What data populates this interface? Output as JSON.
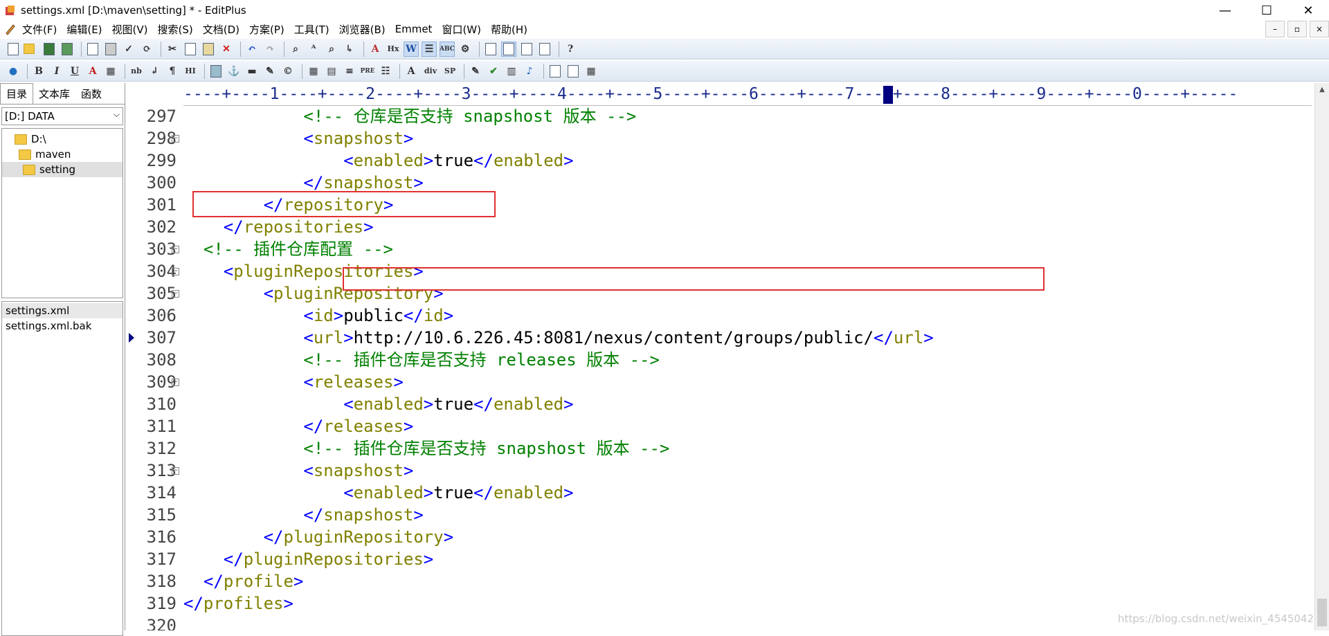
{
  "window": {
    "title": "settings.xml [D:\\maven\\setting] * - EditPlus",
    "controls": {
      "minimize": "—",
      "maximize": "☐",
      "close": "✕"
    }
  },
  "menu": [
    "文件(F)",
    "编辑(E)",
    "视图(V)",
    "搜索(S)",
    "文档(D)",
    "方案(P)",
    "工具(T)",
    "浏览器(B)",
    "Emmet",
    "窗口(W)",
    "帮助(H)"
  ],
  "mdi_controls": {
    "minimize": "–",
    "restore": "▫",
    "close": "×"
  },
  "toolbar2_labels": {
    "bold": "B",
    "italic": "I",
    "underline": "U",
    "font_color": "A",
    "nb": "nb",
    "br": "↲",
    "para": "¶",
    "hr": "HI",
    "pre": "PRE",
    "div": "div",
    "sp": "SP"
  },
  "left_panel": {
    "tabs": [
      "目录",
      "文本库",
      "函数"
    ],
    "drive": "[D:] DATA",
    "tree": [
      "D:\\",
      "maven",
      "setting"
    ],
    "files": [
      "settings.xml",
      "settings.xml.bak"
    ]
  },
  "ruler": "----+----1----+----2----+----3----+----4----+----5----+----6----+----7---",
  "ruler_tail": "+----8----+----9----+----0----+-----",
  "code_lines": [
    {
      "n": "297",
      "indent": "            ",
      "parts": [
        {
          "c": "cm",
          "t": "<!-- 仓库是否支持 snapshost 版本 -->"
        }
      ]
    },
    {
      "n": "298",
      "indent": "            ",
      "fold": "⊟",
      "parts": [
        {
          "c": "tg",
          "t": "<"
        },
        {
          "c": "nm",
          "t": "snapshost"
        },
        {
          "c": "tg",
          "t": ">"
        }
      ]
    },
    {
      "n": "299",
      "indent": "                ",
      "parts": [
        {
          "c": "tg",
          "t": "<"
        },
        {
          "c": "nm",
          "t": "enabled"
        },
        {
          "c": "tg",
          "t": ">"
        },
        {
          "c": "tx",
          "t": "true"
        },
        {
          "c": "tg",
          "t": "</"
        },
        {
          "c": "nm",
          "t": "enabled"
        },
        {
          "c": "tg",
          "t": ">"
        }
      ]
    },
    {
      "n": "300",
      "indent": "            ",
      "parts": [
        {
          "c": "tg",
          "t": "</"
        },
        {
          "c": "nm",
          "t": "snapshost"
        },
        {
          "c": "tg",
          "t": ">"
        }
      ]
    },
    {
      "n": "301",
      "indent": "        ",
      "parts": [
        {
          "c": "tg",
          "t": "</"
        },
        {
          "c": "nm",
          "t": "repository"
        },
        {
          "c": "tg",
          "t": ">"
        }
      ]
    },
    {
      "n": "302",
      "indent": "    ",
      "parts": [
        {
          "c": "tg",
          "t": "</"
        },
        {
          "c": "nm",
          "t": "repositories"
        },
        {
          "c": "tg",
          "t": ">"
        }
      ]
    },
    {
      "n": "303",
      "indent": "  ",
      "fold": "⊟",
      "parts": [
        {
          "c": "cm",
          "t": "<!-- 插件仓库配置 -->"
        }
      ]
    },
    {
      "n": "304",
      "indent": "    ",
      "fold": "⊟",
      "parts": [
        {
          "c": "tg",
          "t": "<"
        },
        {
          "c": "nm",
          "t": "pluginRepositories"
        },
        {
          "c": "tg",
          "t": ">"
        }
      ]
    },
    {
      "n": "305",
      "indent": "        ",
      "fold": "⊟",
      "parts": [
        {
          "c": "tg",
          "t": "<"
        },
        {
          "c": "nm",
          "t": "pluginRepository"
        },
        {
          "c": "tg",
          "t": ">"
        }
      ]
    },
    {
      "n": "306",
      "indent": "            ",
      "parts": [
        {
          "c": "tg",
          "t": "<"
        },
        {
          "c": "nm",
          "t": "id"
        },
        {
          "c": "tg",
          "t": ">"
        },
        {
          "c": "tx",
          "t": "public"
        },
        {
          "c": "tg",
          "t": "</"
        },
        {
          "c": "nm",
          "t": "id"
        },
        {
          "c": "tg",
          "t": ">"
        }
      ]
    },
    {
      "n": "307",
      "indent": "            ",
      "current": true,
      "parts": [
        {
          "c": "tg",
          "t": "<"
        },
        {
          "c": "nm",
          "t": "url"
        },
        {
          "c": "tg",
          "t": ">"
        },
        {
          "c": "tx",
          "t": "http://10.6.226.45:8081/nexus/content/groups/public/"
        },
        {
          "c": "tg",
          "t": "</"
        },
        {
          "c": "nm",
          "t": "url"
        },
        {
          "c": "tg",
          "t": ">"
        }
      ]
    },
    {
      "n": "308",
      "indent": "            ",
      "parts": [
        {
          "c": "cm",
          "t": "<!-- 插件仓库是否支持 releases 版本 -->"
        }
      ]
    },
    {
      "n": "309",
      "indent": "            ",
      "fold": "⊟",
      "parts": [
        {
          "c": "tg",
          "t": "<"
        },
        {
          "c": "nm",
          "t": "releases"
        },
        {
          "c": "tg",
          "t": ">"
        }
      ]
    },
    {
      "n": "310",
      "indent": "                ",
      "parts": [
        {
          "c": "tg",
          "t": "<"
        },
        {
          "c": "nm",
          "t": "enabled"
        },
        {
          "c": "tg",
          "t": ">"
        },
        {
          "c": "tx",
          "t": "true"
        },
        {
          "c": "tg",
          "t": "</"
        },
        {
          "c": "nm",
          "t": "enabled"
        },
        {
          "c": "tg",
          "t": ">"
        }
      ]
    },
    {
      "n": "311",
      "indent": "            ",
      "parts": [
        {
          "c": "tg",
          "t": "</"
        },
        {
          "c": "nm",
          "t": "releases"
        },
        {
          "c": "tg",
          "t": ">"
        }
      ]
    },
    {
      "n": "312",
      "indent": "            ",
      "parts": [
        {
          "c": "cm",
          "t": "<!-- 插件仓库是否支持 snapshost 版本 -->"
        }
      ]
    },
    {
      "n": "313",
      "indent": "            ",
      "fold": "⊟",
      "parts": [
        {
          "c": "tg",
          "t": "<"
        },
        {
          "c": "nm",
          "t": "snapshost"
        },
        {
          "c": "tg",
          "t": ">"
        }
      ]
    },
    {
      "n": "314",
      "indent": "                ",
      "parts": [
        {
          "c": "tg",
          "t": "<"
        },
        {
          "c": "nm",
          "t": "enabled"
        },
        {
          "c": "tg",
          "t": ">"
        },
        {
          "c": "tx",
          "t": "true"
        },
        {
          "c": "tg",
          "t": "</"
        },
        {
          "c": "nm",
          "t": "enabled"
        },
        {
          "c": "tg",
          "t": ">"
        }
      ]
    },
    {
      "n": "315",
      "indent": "            ",
      "parts": [
        {
          "c": "tg",
          "t": "</"
        },
        {
          "c": "nm",
          "t": "snapshost"
        },
        {
          "c": "tg",
          "t": ">"
        }
      ]
    },
    {
      "n": "316",
      "indent": "        ",
      "parts": [
        {
          "c": "tg",
          "t": "</"
        },
        {
          "c": "nm",
          "t": "pluginRepository"
        },
        {
          "c": "tg",
          "t": ">"
        }
      ]
    },
    {
      "n": "317",
      "indent": "    ",
      "parts": [
        {
          "c": "tg",
          "t": "</"
        },
        {
          "c": "nm",
          "t": "pluginRepositories"
        },
        {
          "c": "tg",
          "t": ">"
        }
      ]
    },
    {
      "n": "318",
      "indent": "  ",
      "parts": [
        {
          "c": "tg",
          "t": "</"
        },
        {
          "c": "nm",
          "t": "profile"
        },
        {
          "c": "tg",
          "t": ">"
        }
      ]
    },
    {
      "n": "319",
      "indent": "",
      "parts": [
        {
          "c": "tg",
          "t": "</"
        },
        {
          "c": "nm",
          "t": "profiles"
        },
        {
          "c": "tg",
          "t": ">"
        }
      ]
    },
    {
      "n": "320",
      "indent": "",
      "parts": []
    }
  ],
  "watermark": "https://blog.csdn.net/weixin_4545042",
  "colors": {
    "comment": "#008000",
    "tag_bracket": "#0000ff",
    "tag_name": "#808000",
    "text": "#000000",
    "highlight_box": "#e03030"
  }
}
